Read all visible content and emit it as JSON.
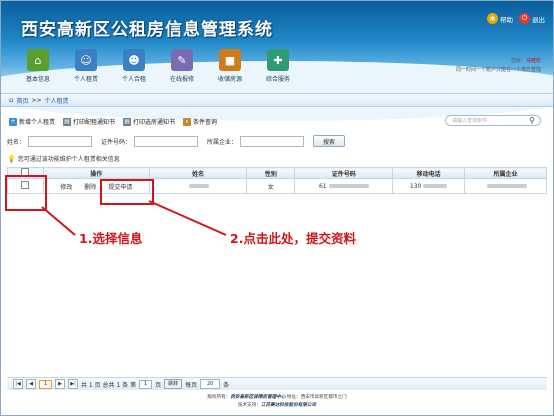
{
  "app": {
    "title": "西安高新区公租房信息管理系统"
  },
  "top_links": [
    {
      "label": "帮助",
      "icon": "help-icon",
      "color": "#f0a400"
    },
    {
      "label": "退出",
      "icon": "power-icon",
      "color": "#e03a2f"
    }
  ],
  "nav": [
    {
      "label": "基本信息",
      "icon": "house-icon",
      "color": "#5a9e2f",
      "glyph": "⌂"
    },
    {
      "label": "个人租赁",
      "icon": "user-icon",
      "color": "#3b7fc4",
      "glyph": "☺"
    },
    {
      "label": "个人合租",
      "icon": "users-icon",
      "color": "#3b7fc4",
      "glyph": "☻"
    },
    {
      "label": "在线报修",
      "icon": "wrench-icon",
      "color": "#7b6bb3",
      "glyph": "✎"
    },
    {
      "label": "收储房源",
      "icon": "book-icon",
      "color": "#d07a1a",
      "glyph": "■"
    },
    {
      "label": "综合服务",
      "icon": "service-icon",
      "color": "#2f9a76",
      "glyph": "✚"
    }
  ],
  "welcome": {
    "greeting": "您好：",
    "user": "马桂珍",
    "note": "同一时间一个账户只能在一个地方登陆"
  },
  "breadcrumb": {
    "home": "首页",
    "sep": ">>",
    "current": "个人租赁"
  },
  "toolbar": [
    {
      "label": "新增个人租赁",
      "icon": "add-icon",
      "color": "#3a8fd6",
      "glyph": "+"
    },
    {
      "label": "打印配租通知书",
      "icon": "print-icon",
      "color": "#6b7f93",
      "glyph": "▤"
    },
    {
      "label": "打印选房通知书",
      "icon": "print-icon",
      "color": "#6b7f93",
      "glyph": "▤"
    },
    {
      "label": "条件查询",
      "icon": "magnifier-icon",
      "color": "#c7862a",
      "glyph": "⌕"
    }
  ],
  "search": {
    "placeholder": "请输入查询条件"
  },
  "filter": {
    "name_label": "姓名：",
    "id_label": "证件号码：",
    "company_label": "所属企业：",
    "search_button": "搜索"
  },
  "tip": "您可通过该功能维护个人租赁相关信息",
  "grid": {
    "headers": [
      "",
      "操作",
      "姓名",
      "性别",
      "证件号码",
      "移动电话",
      "所属企业"
    ],
    "row": {
      "actions": [
        "修改",
        "删除",
        "提交申请"
      ],
      "gender": "女",
      "id_prefix": "61",
      "phone_prefix": "130"
    }
  },
  "callouts": {
    "step1": "1.选择信息",
    "step2": "2.点击此处，提交资料",
    "color": "#d1151b"
  },
  "pager": {
    "first": "|◀",
    "prev": "◀",
    "page_input": "1",
    "next": "▶",
    "last": "▶|",
    "range": "共 1 页 总共 1 条 第",
    "page_unit": "页",
    "go": "跳转",
    "per_page_label": "每页",
    "per_page": "20",
    "per_page_unit": "条"
  },
  "footer": {
    "line1_prefix": "版权所有：",
    "line1_org": "西安高新区保障房管理中心",
    "line1_addr": "地址：西安市高新区都市之门",
    "line2_prefix": "技术支持：",
    "line2_org": "江苏赛达科技股份有限公司"
  }
}
